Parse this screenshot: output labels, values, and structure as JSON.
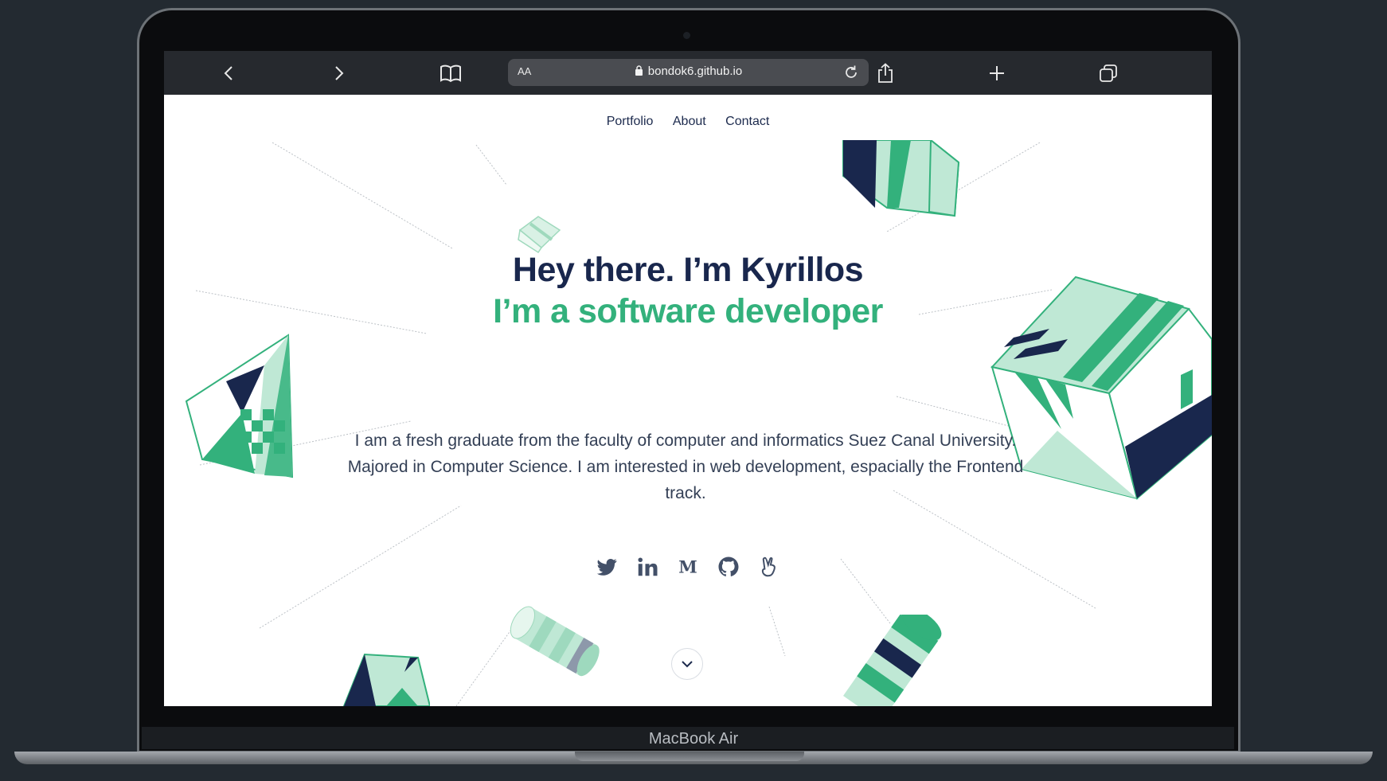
{
  "browser": {
    "text_size_label": "AA",
    "url": "bondok6.github.io"
  },
  "nav": {
    "items": [
      "Portfolio",
      "About",
      "Contact"
    ]
  },
  "hero": {
    "title": "Hey there. I’m Kyrillos",
    "subtitle": "I’m a software developer",
    "bio": "I am a fresh graduate from the faculty of computer and informatics Suez Canal University. Majored in Computer Science. I am interested in web development, espacially the Frontend track."
  },
  "socials": [
    "twitter-icon",
    "linkedin-icon",
    "medium-icon",
    "github-icon",
    "angellist-icon"
  ],
  "device": {
    "brand": "MacBook Air"
  },
  "colors": {
    "navy": "#19274d",
    "green": "#33b17c",
    "mint": "#bfe8d5"
  }
}
